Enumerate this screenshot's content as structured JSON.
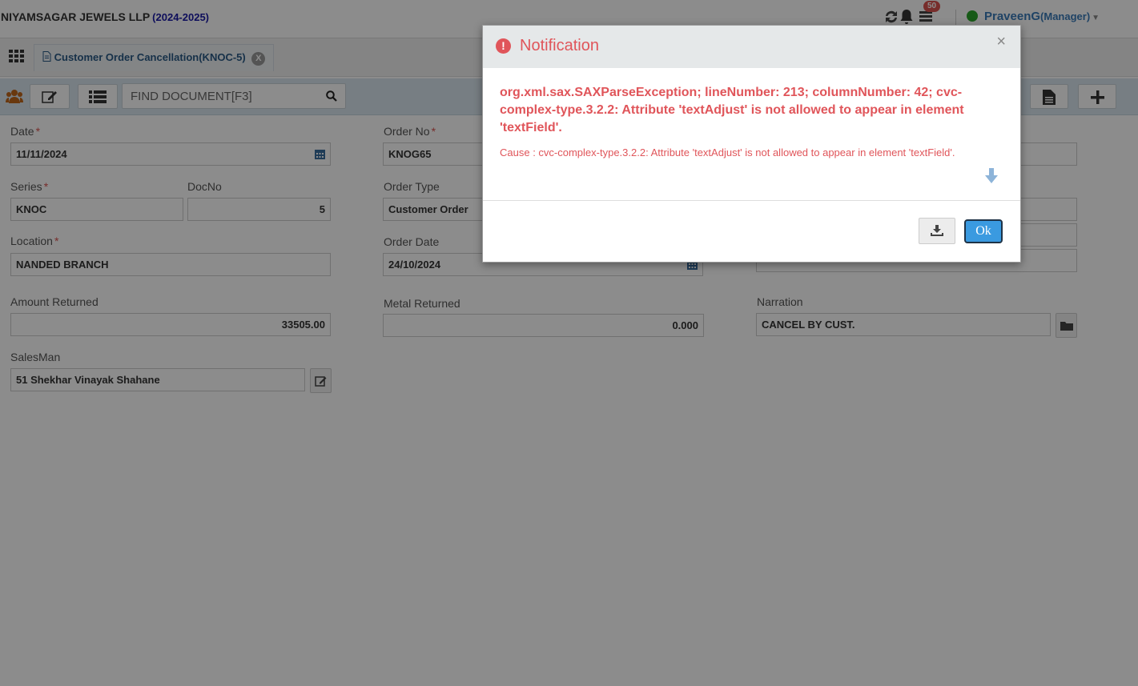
{
  "header": {
    "company": "NIYAMSAGAR JEWELS LLP",
    "fiscal_year": "(2024-2025)",
    "notification_count": "50",
    "user_name": "PraveenG",
    "user_role": "(Manager)"
  },
  "tab": {
    "label": "Customer Order Cancellation(KNOC-5)",
    "close": "X"
  },
  "toolbar": {
    "find_placeholder": "FIND DOCUMENT[F3]"
  },
  "form": {
    "date_label": "Date",
    "date_value": "11/11/2024",
    "order_no_label": "Order No",
    "order_no_value": "KNOG65",
    "series_label": "Series",
    "series_value": "KNOC",
    "docno_label": "DocNo",
    "docno_value": "5",
    "order_type_label": "Order Type",
    "order_type_value": "Customer Order",
    "location_label": "Location",
    "location_value": "NANDED BRANCH",
    "order_date_label": "Order Date",
    "order_date_value": "24/10/2024",
    "amount_returned_label": "Amount Returned",
    "amount_returned_value": "33505.00",
    "metal_returned_label": "Metal Returned",
    "metal_returned_value": "0.000",
    "narration_label": "Narration",
    "narration_value": "CANCEL BY CUST.",
    "salesman_label": "SalesMan",
    "salesman_value": "51 Shekhar Vinayak Shahane",
    "required_mark": "*"
  },
  "modal": {
    "title": "Notification",
    "close": "×",
    "error_icon": "!",
    "message": "org.xml.sax.SAXParseException; lineNumber: 213; columnNumber: 42; cvc-complex-type.3.2.2: Attribute 'textAdjust' is not allowed to appear in element 'textField'.",
    "cause": "Cause : cvc-complex-type.3.2.2: Attribute 'textAdjust' is not allowed to appear in element 'textField'.",
    "ok_label": "Ok"
  },
  "colors": {
    "error": "#e0555a",
    "ok_button": "#3a9ae0",
    "toolbar_bg": "#d9e6ee",
    "fiscal_year": "#1a1aa6"
  },
  "icons": [
    "refresh-icon",
    "bell-icon",
    "inbox-icon",
    "apps-grid-icon",
    "document-icon",
    "users-icon",
    "edit-icon",
    "list-icon",
    "search-icon",
    "calendar-icon",
    "download-icon",
    "arrow-down-icon",
    "plus-icon",
    "page-icon"
  ]
}
